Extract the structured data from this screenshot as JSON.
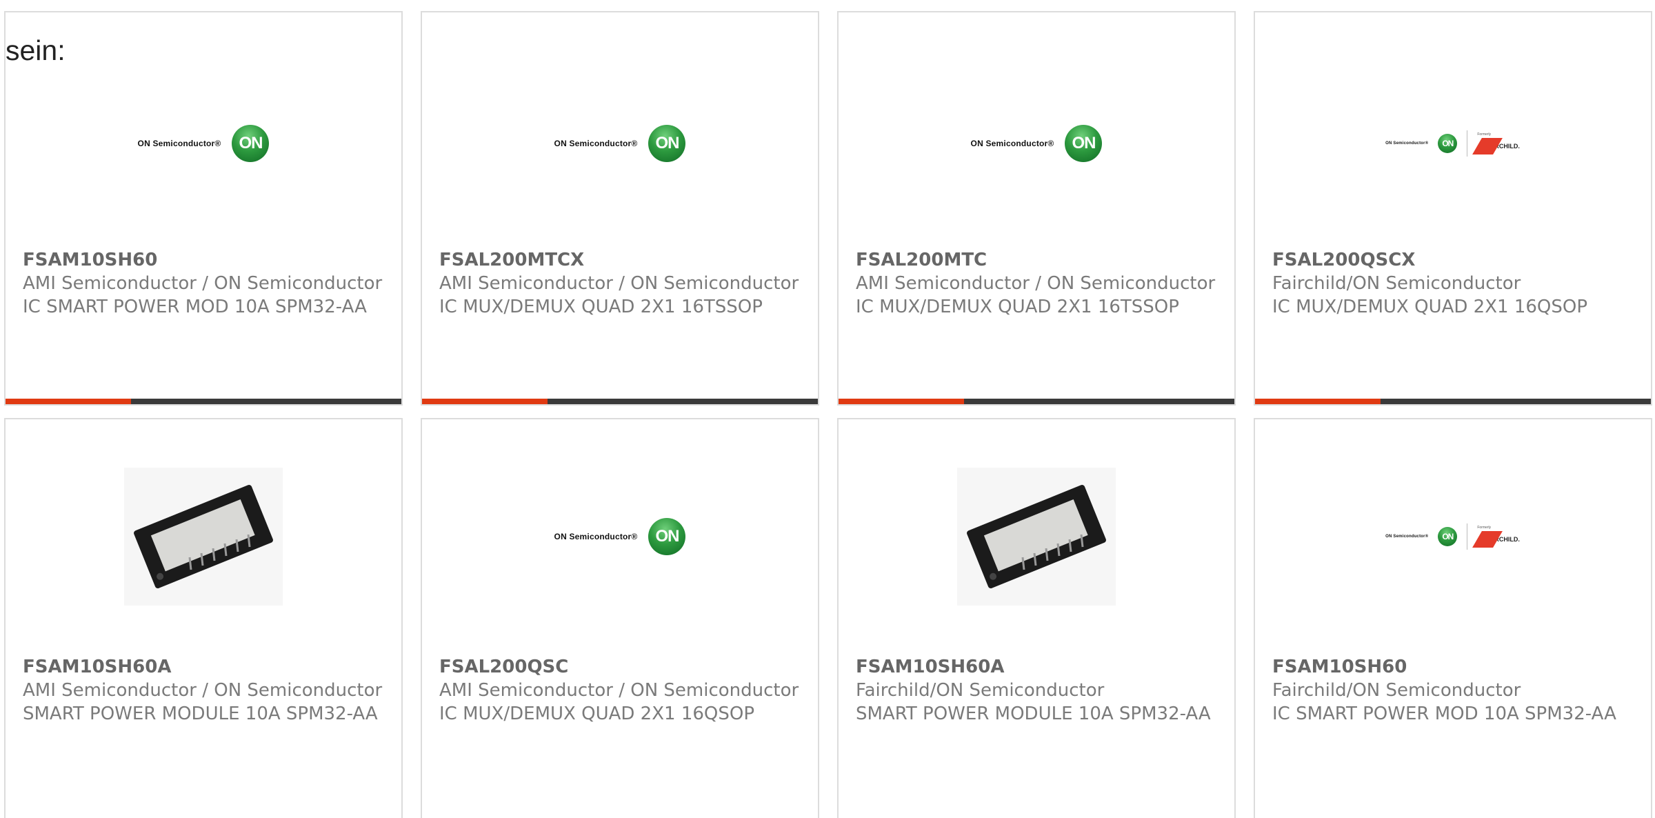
{
  "intro": "sein:",
  "logos": {
    "on_text": "ON Semiconductor®",
    "on_mark": "ON",
    "formerly": "Formerly",
    "fairchild": "FAIRCHILD."
  },
  "cards": [
    {
      "part": "FSAM10SH60",
      "maker": "AMI Semiconductor / ON Semiconductor",
      "desc": "IC SMART POWER MOD 10A SPM32-AA",
      "image": "on-semiconductor-logo"
    },
    {
      "part": "FSAL200MTCX",
      "maker": "AMI Semiconductor / ON Semiconductor",
      "desc": "IC MUX/DEMUX QUAD 2X1 16TSSOP",
      "image": "on-semiconductor-logo"
    },
    {
      "part": "FSAL200MTC",
      "maker": "AMI Semiconductor / ON Semiconductor",
      "desc": "IC MUX/DEMUX QUAD 2X1 16TSSOP",
      "image": "on-semiconductor-logo"
    },
    {
      "part": "FSAL200QSCX",
      "maker": "Fairchild/ON Semiconductor",
      "desc": "IC MUX/DEMUX QUAD 2X1 16QSOP",
      "image": "on-fairchild-logo"
    },
    {
      "part": "FSAM10SH60A",
      "maker": "AMI Semiconductor / ON Semiconductor",
      "desc": "SMART POWER MODULE 10A SPM32-AA",
      "image": "power-module-photo"
    },
    {
      "part": "FSAL200QSC",
      "maker": "AMI Semiconductor / ON Semiconductor",
      "desc": "IC MUX/DEMUX QUAD 2X1 16QSOP",
      "image": "on-semiconductor-logo"
    },
    {
      "part": "FSAM10SH60A",
      "maker": "Fairchild/ON Semiconductor",
      "desc": "SMART POWER MODULE 10A SPM32-AA",
      "image": "power-module-photo"
    },
    {
      "part": "FSAM10SH60",
      "maker": "Fairchild/ON Semiconductor",
      "desc": "IC SMART POWER MOD 10A SPM32-AA",
      "image": "on-fairchild-logo"
    }
  ],
  "colors": {
    "accent": "#e03a12",
    "bar": "#3a3a3a",
    "border": "#dcdcdc"
  }
}
